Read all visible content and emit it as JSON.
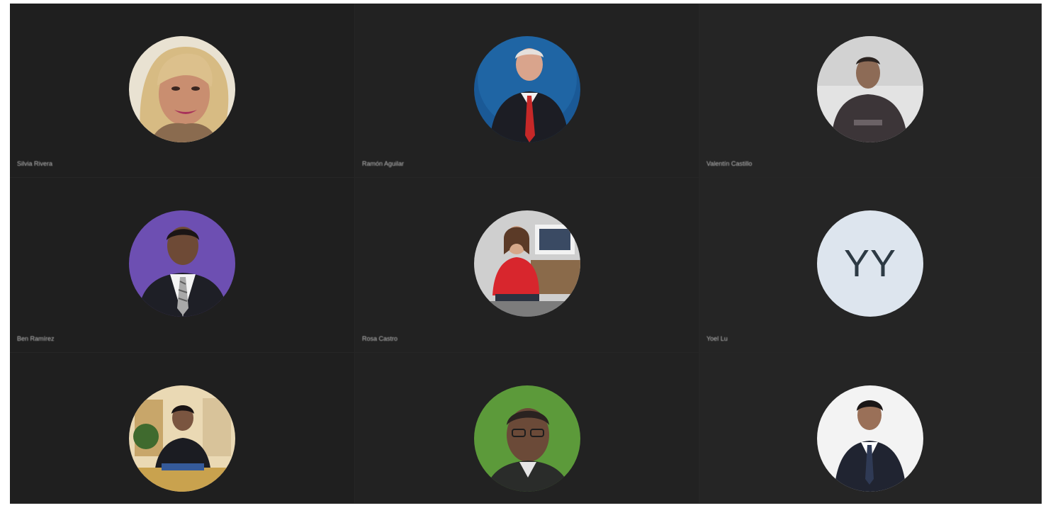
{
  "meeting": {
    "participants": [
      {
        "name": "Silvia Rivera",
        "avatar": "photo-woman-blonde-icon",
        "bg": "#c9b08a"
      },
      {
        "name": "Ramón Aguilar",
        "avatar": "photo-man-suit-red-tie-icon",
        "bg": "#1d5c95"
      },
      {
        "name": "Valentín Castillo",
        "avatar": "photo-man-hoodie-icon",
        "bg": "#dcdcdc"
      },
      {
        "name": "Ben Ramírez",
        "avatar": "photo-man-suit-purple-icon",
        "bg": "#6e4eb0"
      },
      {
        "name": "Rosa Castro",
        "avatar": "photo-woman-red-jacket-icon",
        "bg": "#d8d8d8"
      },
      {
        "name": "Yoel Lu",
        "initials": "YY",
        "avatar": "initials-avatar",
        "bg": "#dde5ee"
      },
      {
        "name": "",
        "avatar": "photo-man-desk-icon",
        "bg": "#e8d7b0"
      },
      {
        "name": "",
        "avatar": "photo-man-glasses-green-icon",
        "bg": "#5e9a3c"
      },
      {
        "name": "",
        "avatar": "photo-man-suit-white-icon",
        "bg": "#f4f4f4"
      }
    ]
  }
}
